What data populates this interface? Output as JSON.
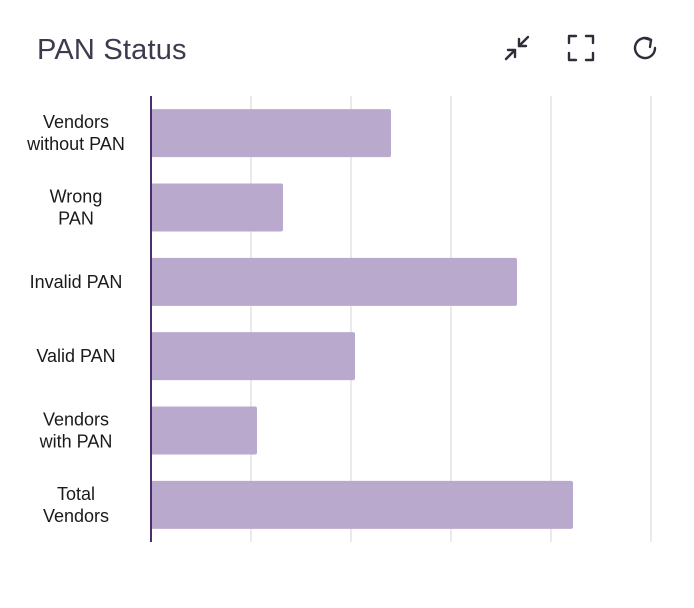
{
  "header": {
    "title": "PAN Status"
  },
  "toolbar": {
    "icons": [
      "collapse-icon",
      "fullscreen-icon",
      "refresh-icon"
    ]
  },
  "colors": {
    "bar": "#b9a9cc",
    "axis": "#4b2f6b",
    "grid": "#e4e4e4",
    "icon": "#2e2e3a"
  },
  "chart_data": {
    "type": "bar",
    "orientation": "horizontal",
    "title": "PAN Status",
    "categories": [
      [
        "Vendors",
        "without PAN"
      ],
      [
        "Wrong",
        "PAN"
      ],
      [
        "Invalid PAN"
      ],
      [
        "Valid PAN"
      ],
      [
        "Vendors",
        "with PAN"
      ],
      [
        "Total",
        "Vendors"
      ]
    ],
    "values": [
      2.4,
      1.32,
      3.66,
      2.04,
      1.06,
      4.22
    ],
    "xlim": [
      0,
      5
    ],
    "grid": true,
    "legend": "none"
  }
}
